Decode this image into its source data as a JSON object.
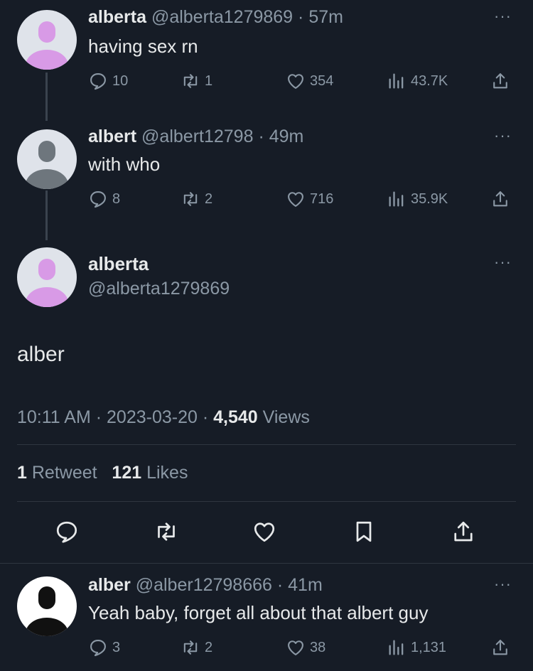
{
  "thread": [
    {
      "name": "alberta",
      "handle": "@alberta1279869",
      "dot": "·",
      "time": "57m",
      "text": "having sex rn",
      "more": "···",
      "replies": "10",
      "retweets": "1",
      "likes": "354",
      "views": "43.7K",
      "avatar_color": "#d89ae6",
      "avatar_bg": "#dfe3ea"
    },
    {
      "name": "albert",
      "handle": "@albert12798",
      "dot": "·",
      "time": "49m",
      "text": "with who",
      "more": "···",
      "replies": "8",
      "retweets": "2",
      "likes": "716",
      "views": "35.9K",
      "avatar_color": "#6e767d",
      "avatar_bg": "#dfe3ea"
    }
  ],
  "focus": {
    "name": "alberta",
    "handle": "@alberta1279869",
    "more": "···",
    "text": "alber",
    "time": "10:11 AM",
    "date": "2023-03-20",
    "dot": "·",
    "views_count": "4,540",
    "views_label": "Views",
    "retweets_count": "1",
    "retweets_label": "Retweet",
    "likes_count": "121",
    "likes_label": "Likes"
  },
  "reply": {
    "name": "alber",
    "handle": "@alber12798666",
    "dot": "·",
    "time": "41m",
    "text": "Yeah baby, forget all about that albert guy",
    "more": "···",
    "replies": "3",
    "retweets": "2",
    "likes": "38",
    "views": "1,131",
    "avatar_color": "#111111",
    "avatar_bg": "#ffffff"
  },
  "icons": {
    "reply": "reply-icon",
    "retweet": "retweet-icon",
    "like": "heart-icon",
    "views": "views-icon",
    "share": "share-icon",
    "bookmark": "bookmark-icon"
  },
  "colors": {
    "background": "#161c26",
    "text": "#e7e9ea",
    "muted": "#8b98a5"
  }
}
